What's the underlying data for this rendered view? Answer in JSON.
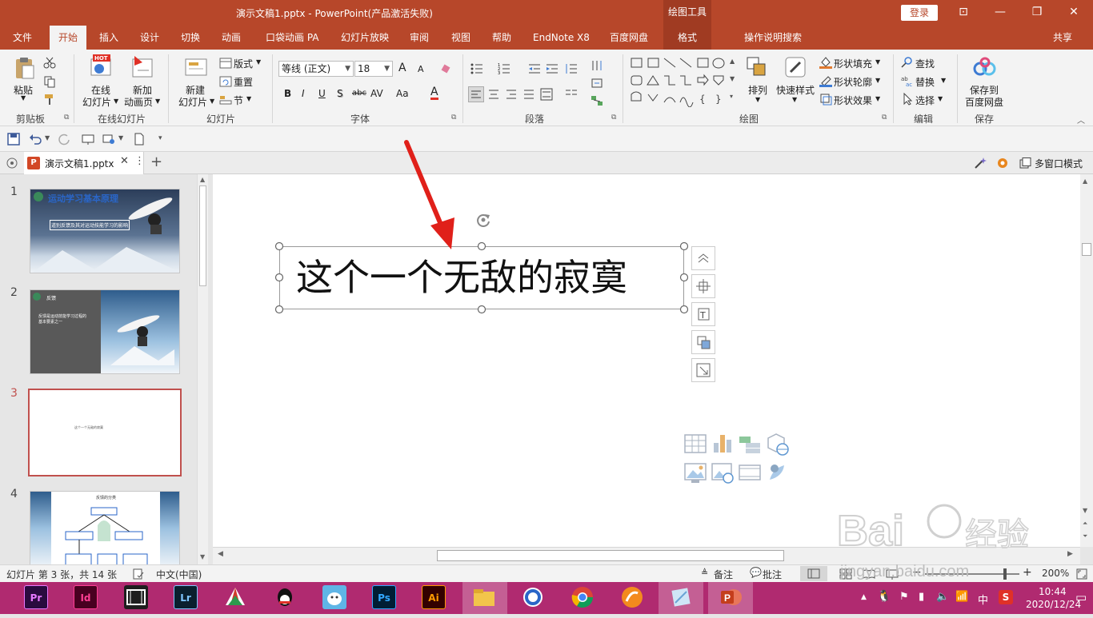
{
  "titlebar": {
    "title": "演示文稿1.pptx  -  PowerPoint(产品激活失败)",
    "context_tool": "绘图工具",
    "login_label": "登录",
    "min_glyph": "—",
    "restore_glyph": "❐",
    "close_glyph": "✕",
    "ribbon_toggle_glyph": "⊡"
  },
  "tabs": {
    "file": "文件",
    "home": "开始",
    "insert": "插入",
    "design": "设计",
    "transitions": "切换",
    "animations": "动画",
    "pocket_anim": "口袋动画 PA",
    "slideshow": "幻灯片放映",
    "review": "审阅",
    "view": "视图",
    "help": "帮助",
    "endnote": "EndNote X8",
    "baidu": "百度网盘",
    "format": "格式",
    "tell_me": "操作说明搜索",
    "share": "共享"
  },
  "ribbon": {
    "clipboard": {
      "paste": "粘贴",
      "group": "剪贴板"
    },
    "online_slides": {
      "online": "在线",
      "online2": "幻灯片",
      "new": "新加",
      "new2": "动画页",
      "group": "在线幻灯片",
      "hot": "HOT"
    },
    "slides": {
      "new": "新建",
      "new2": "幻灯片",
      "layout": "版式",
      "reset": "重置",
      "section": "节",
      "group": "幻灯片"
    },
    "font": {
      "font_name": "等线 (正文)",
      "font_size": "18",
      "bold": "B",
      "italic": "I",
      "underline": "U",
      "shadow": "S",
      "strike": "abc",
      "spacing": "AV",
      "case": "Aa",
      "color": "A",
      "grow": "A",
      "shrink": "A",
      "group": "字体"
    },
    "paragraph": {
      "group": "段落"
    },
    "drawing": {
      "arrange": "排列",
      "quick_style": "快速样式",
      "fill": "形状填充",
      "outline": "形状轮廓",
      "effect": "形状效果",
      "group": "绘图"
    },
    "editing": {
      "find": "查找",
      "replace": "替换",
      "select": "选择",
      "group": "编辑"
    },
    "save": {
      "save_to": "保存到",
      "baidu": "百度网盘",
      "group": "保存"
    }
  },
  "doctabs": {
    "doc_name": "演示文稿1.pptx",
    "multi_window": "多窗口模式",
    "add": "+"
  },
  "slides": [
    {
      "num": "1",
      "title": "运动学习基本原理",
      "subtitle": "道别反馈及其对运动技能学习的影响"
    },
    {
      "num": "2",
      "title": "反馈",
      "body": "反馈是运动技能学习过程的基本要素之一"
    },
    {
      "num": "3",
      "text": "这个一个无敌的寂寞"
    },
    {
      "num": "4",
      "title": "反馈的分类"
    }
  ],
  "canvas": {
    "textbox_text": "这个一个无敌的寂寞"
  },
  "statusbar": {
    "slide_info": "幻灯片 第 3 张，共 14 张",
    "language": "中文(中国)",
    "notes": "备注",
    "comments": "批注",
    "zoom": "200%",
    "watermark": "jingyan.baidu.com"
  },
  "taskbar": {
    "apps": [
      "Pr",
      "Id",
      "Lr",
      "Ps",
      "Ai"
    ],
    "time": "10:44",
    "date": "2020/12/24",
    "ime": "中"
  },
  "colors": {
    "accent": "#b7472a",
    "taskbar": "#b02a70",
    "arrow": "#e0201a"
  }
}
